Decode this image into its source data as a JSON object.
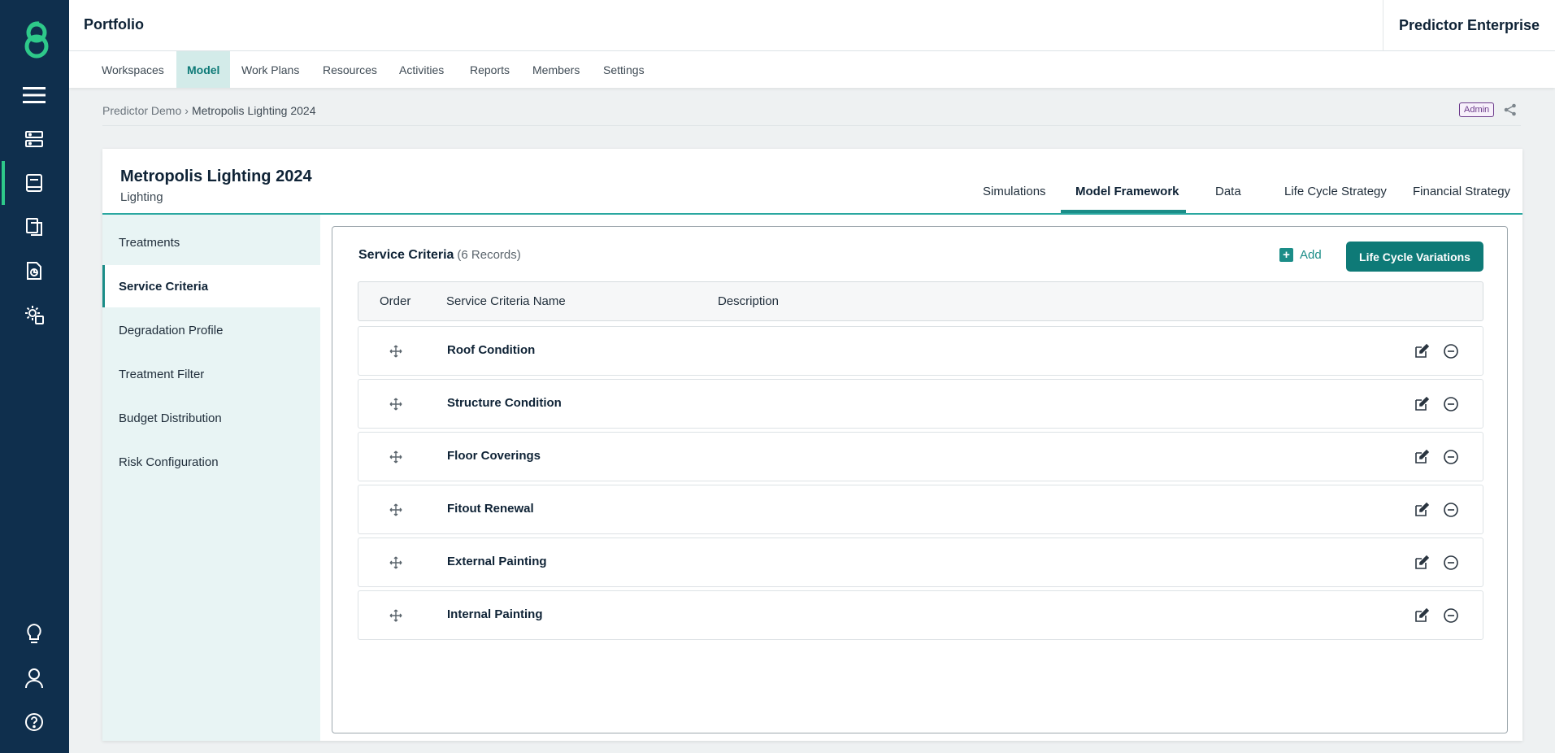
{
  "app": {
    "title": "Portfolio",
    "brand": "Predictor Enterprise"
  },
  "nav": [
    "Workspaces",
    "Model",
    "Work Plans",
    "Resources",
    "Activities",
    "Reports",
    "Members",
    "Settings"
  ],
  "nav_active": "Model",
  "breadcrumb": {
    "parent": "Predictor Demo",
    "separator": "›",
    "current": "Metropolis Lighting 2024"
  },
  "role_badge": "Admin",
  "model": {
    "name": "Metropolis Lighting 2024",
    "category": "Lighting"
  },
  "tabs": [
    "Simulations",
    "Model Framework",
    "Data",
    "Life Cycle Strategy",
    "Financial Strategy"
  ],
  "active_tab": "Model Framework",
  "sidebar": [
    "Treatments",
    "Service Criteria",
    "Degradation Profile",
    "Treatment Filter",
    "Budget Distribution",
    "Risk Configuration"
  ],
  "sidebar_active": "Service Criteria",
  "panel": {
    "title": "Service Criteria",
    "count": "(6 Records)",
    "add_label": "Add",
    "primary_button": "Life Cycle Variations",
    "columns": {
      "order": "Order",
      "name": "Service Criteria Name",
      "description": "Description"
    },
    "rows": [
      "Roof Condition",
      "Structure Condition",
      "Floor Coverings",
      "Fitout Renewal",
      "External Painting",
      "Internal Painting"
    ]
  },
  "colors": {
    "rail": "#0f2f4d",
    "accent": "#0e7a77",
    "logo": "#2ec98a"
  }
}
